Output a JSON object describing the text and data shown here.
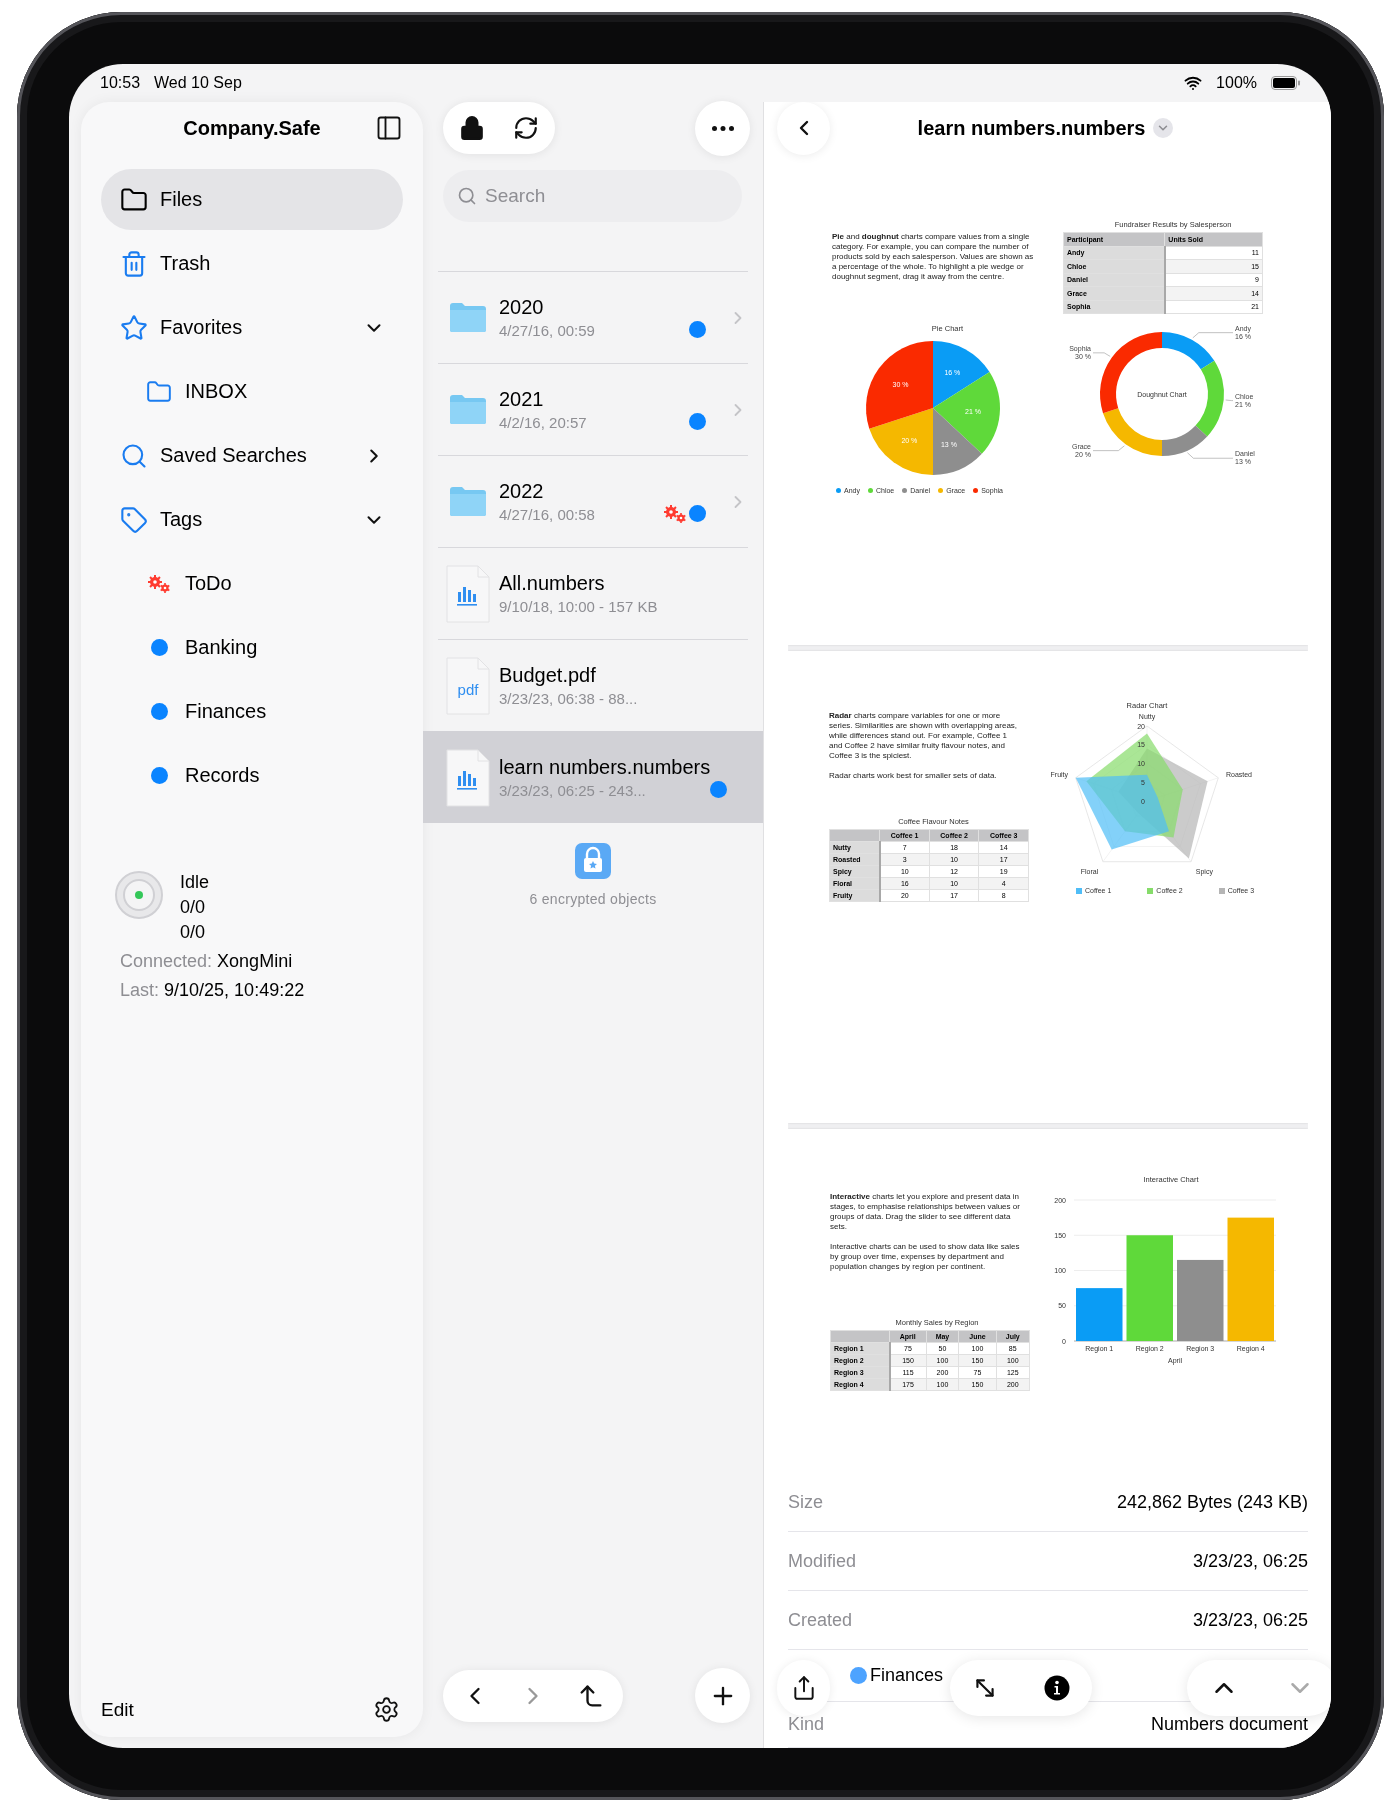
{
  "status_bar": {
    "time": "10:53",
    "date": "Wed 10 Sep",
    "battery": "100%"
  },
  "sidebar": {
    "title": "Company.Safe",
    "items": [
      {
        "kind": "nav",
        "label": "Files",
        "selected": true
      },
      {
        "kind": "nav",
        "label": "Trash",
        "selected": false
      },
      {
        "kind": "section",
        "label": "Favorites",
        "selected": false,
        "expanded": true,
        "children": [
          {
            "kind": "folder",
            "label": "INBOX",
            "selected": false
          }
        ]
      },
      {
        "kind": "section",
        "label": "Saved Searches",
        "selected": false,
        "expanded": false
      },
      {
        "kind": "section",
        "label": "Tags",
        "selected": false,
        "expanded": true,
        "children": [
          {
            "kind": "gears",
            "label": "ToDo",
            "selected": false
          },
          {
            "kind": "dot",
            "label": "Banking",
            "color": "#0a84ff",
            "selected": false
          },
          {
            "kind": "dot",
            "label": "Finances",
            "color": "#0a84ff",
            "selected": false
          },
          {
            "kind": "dot",
            "label": "Records",
            "color": "#0a84ff",
            "selected": false
          }
        ]
      }
    ],
    "sync": {
      "state": "Idle",
      "counts": [
        "0/0",
        "0/0"
      ],
      "connected_label": "Connected:",
      "connected": "XongMini",
      "last_label": "Last:",
      "last": "9/10/25, 10:49:22"
    },
    "edit": "Edit"
  },
  "file_list": {
    "search": {
      "placeholder": "Search"
    },
    "items": [
      {
        "kind": "folder",
        "name": "2020",
        "meta": "4/27/16, 00:59",
        "selected": false,
        "tags": [
          {
            "kind": "dot",
            "color": "#0a84ff"
          }
        ]
      },
      {
        "kind": "folder",
        "name": "2021",
        "meta": "4/2/16, 20:57",
        "selected": false,
        "tags": [
          {
            "kind": "dot",
            "color": "#0a84ff"
          }
        ]
      },
      {
        "kind": "folder",
        "name": "2022",
        "meta": "4/27/16, 00:58",
        "selected": false,
        "tags": [
          {
            "kind": "gears"
          },
          {
            "kind": "dot",
            "color": "#0a84ff"
          }
        ]
      },
      {
        "kind": "numbers",
        "name": "All.numbers",
        "meta": "9/10/18, 10:00 - 157 KB",
        "selected": false
      },
      {
        "kind": "pdf",
        "icon_text": "pdf",
        "name": "Budget.pdf",
        "meta": "3/23/23, 06:38 - 88...",
        "selected": false
      },
      {
        "kind": "numbers",
        "name": "learn numbers.numbers",
        "meta": "3/23/23, 06:25 - 243...",
        "selected": true,
        "tags": [
          {
            "kind": "dot",
            "color": "#0a84ff"
          }
        ]
      }
    ],
    "footer": "6 encrypted objects"
  },
  "detail": {
    "title": "learn numbers.numbers",
    "pages": [
      {
        "kind": "pie",
        "paragraphs": [
          "**Pie** and **doughnut** charts compare values from a single category. For example, you can compare the number of products sold by each salesperson. Values are shown as a percentage of the whole. To highlight a pie wedge or doughnut segment, drag it away from the centre."
        ],
        "table": {
          "title": "Fundraiser Results by Salesperson",
          "corner": "Participant",
          "columns": [
            "Units Sold"
          ],
          "rows": [
            {
              "label": "Andy",
              "values": [
                "11"
              ]
            },
            {
              "label": "Chloe",
              "values": [
                "15"
              ]
            },
            {
              "label": "Daniel",
              "values": [
                "9"
              ]
            },
            {
              "label": "Grace",
              "values": [
                "14"
              ]
            },
            {
              "label": "Sophia",
              "values": [
                "21"
              ]
            }
          ]
        },
        "pie": {
          "chart_data": {
            "type": "pie",
            "title": "Pie Chart",
            "categories": [
              "Andy",
              "Chloe",
              "Daniel",
              "Grace",
              "Sophia"
            ],
            "values": [
              16,
              21,
              13,
              20,
              30
            ],
            "colors": [
              "#0a9cf5",
              "#5fd93a",
              "#8e8e8e",
              "#f5b800",
              "#fa2a00"
            ],
            "legend": "bottom",
            "value_labels": [
              "16 %",
              "21 %",
              "13 %",
              "20 %",
              "30 %"
            ]
          }
        },
        "doughnut": {
          "chart_data": {
            "type": "donut",
            "title": "Doughnut Chart",
            "categories": [
              "Andy",
              "Chloe",
              "Daniel",
              "Grace",
              "Sophia"
            ],
            "values": [
              16,
              21,
              13,
              20,
              30
            ],
            "colors": [
              "#0a9cf5",
              "#5fd93a",
              "#8e8e8e",
              "#f5b800",
              "#fa2a00"
            ],
            "value_labels": [
              "16 %",
              "21 %",
              "13 %",
              "20 %",
              "30 %"
            ]
          }
        }
      },
      {
        "kind": "radar",
        "paragraphs": [
          "**Radar** charts compare variables for one or more series. Similarities are shown with overlapping areas, while differences stand out. For example, Coffee 1 and Coffee 2 have similar fruity flavour notes, and Coffee 3 is the spiciest.",
          "Radar charts work best for smaller sets of data."
        ],
        "table": {
          "title": "Coffee Flavour Notes",
          "columns": [
            "Coffee 1",
            "Coffee 2",
            "Coffee 3"
          ],
          "rows": [
            {
              "label": "Nutty",
              "values": [
                "7",
                "18",
                "14"
              ]
            },
            {
              "label": "Roasted",
              "values": [
                "3",
                "10",
                "17"
              ]
            },
            {
              "label": "Spicy",
              "values": [
                "10",
                "12",
                "19"
              ]
            },
            {
              "label": "Floral",
              "values": [
                "16",
                "10",
                "4"
              ]
            },
            {
              "label": "Fruity",
              "values": [
                "20",
                "17",
                "8"
              ]
            }
          ]
        },
        "radar": {
          "title": "Radar Chart",
          "axes": [
            "Nutty",
            "Roasted",
            "Spicy",
            "Floral",
            "Fruity"
          ],
          "ticks": [
            "20",
            "15",
            "10",
            "5",
            "0"
          ],
          "series": [
            {
              "name": "Coffee 1",
              "color": "#4fbdf7"
            },
            {
              "name": "Coffee 2",
              "color": "#86dc6a"
            },
            {
              "name": "Coffee 3",
              "color": "#b5b5b5"
            }
          ]
        }
      },
      {
        "kind": "bar",
        "paragraphs": [
          "**Interactive** charts let you explore and present data in stages, to emphasise relationships between values or groups of data. Drag the slider to see different data sets.",
          "Interactive charts can be used to show data like sales by group over time, expenses by department and population changes by region per continent."
        ],
        "table": {
          "title": "Monthly Sales by Region",
          "columns": [
            "April",
            "May",
            "June",
            "July"
          ],
          "rows": [
            {
              "label": "Region 1",
              "values": [
                "75",
                "50",
                "100",
                "85"
              ]
            },
            {
              "label": "Region 2",
              "values": [
                "150",
                "100",
                "150",
                "100"
              ]
            },
            {
              "label": "Region 3",
              "values": [
                "115",
                "200",
                "75",
                "125"
              ]
            },
            {
              "label": "Region 4",
              "values": [
                "175",
                "100",
                "150",
                "200"
              ]
            }
          ]
        },
        "bar": {
          "chart_data": {
            "type": "bar",
            "title": "Interactive Chart",
            "categories": [
              "Region 1",
              "Region 2",
              "Region 3",
              "Region 4"
            ],
            "ylim": [
              0,
              200
            ],
            "yticks": [
              0,
              50,
              100,
              150,
              200
            ],
            "grid": true,
            "colors": [
              "#0a9cf5",
              "#5fd93a",
              "#8e8e8e",
              "#f5b800"
            ],
            "series": [
              {
                "name": "April",
                "values": [
                  75,
                  150,
                  115,
                  175
                ]
              }
            ]
          }
        }
      }
    ],
    "info": [
      {
        "kind": "text",
        "label": "Size",
        "value": "242,862 Bytes (243 KB)"
      },
      {
        "kind": "text",
        "label": "Modified",
        "value": "3/23/23, 06:25"
      },
      {
        "kind": "text",
        "label": "Created",
        "value": "3/23/23, 06:25"
      },
      {
        "kind": "tag",
        "value": "Finances",
        "color": "#4da3ff"
      },
      {
        "kind": "text",
        "label": "Kind",
        "value": "Numbers document"
      }
    ]
  }
}
